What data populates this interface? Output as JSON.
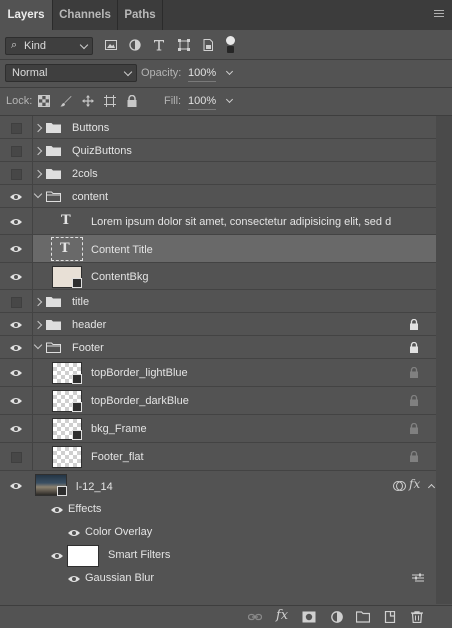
{
  "tabs": [
    {
      "label": "Layers",
      "active": true
    },
    {
      "label": "Channels",
      "active": false
    },
    {
      "label": "Paths",
      "active": false
    }
  ],
  "filter": {
    "kind_label": "Kind"
  },
  "blend": {
    "mode": "Normal",
    "opacity_label": "Opacity:",
    "opacity_value": "100%",
    "lock_label": "Lock:",
    "fill_label": "Fill:",
    "fill_value": "100%"
  },
  "layers": [
    {
      "name": "Buttons",
      "type": "group",
      "visible": false,
      "expanded": false,
      "indent": 0
    },
    {
      "name": "QuizButtons",
      "type": "group",
      "visible": false,
      "expanded": false,
      "indent": 0
    },
    {
      "name": "2cols",
      "type": "group",
      "visible": false,
      "expanded": false,
      "indent": 0
    },
    {
      "name": "content",
      "type": "group",
      "visible": true,
      "expanded": true,
      "indent": 0
    },
    {
      "name": "Lorem ipsum dolor sit amet, consectetur adipisicing elit, sed d",
      "type": "text",
      "visible": true,
      "indent": 1
    },
    {
      "name": "Content Title",
      "type": "text",
      "visible": true,
      "indent": 1,
      "selected": true
    },
    {
      "name": "ContentBkg",
      "type": "smart-object",
      "visible": true,
      "indent": 1
    },
    {
      "name": "title",
      "type": "group",
      "visible": false,
      "expanded": false,
      "indent": 0
    },
    {
      "name": "header",
      "type": "group",
      "visible": true,
      "expanded": false,
      "indent": 0,
      "locked": true
    },
    {
      "name": "Footer",
      "type": "group",
      "visible": true,
      "expanded": true,
      "indent": 0,
      "locked": true
    },
    {
      "name": "topBorder_lightBlue",
      "type": "smart-object",
      "visible": true,
      "indent": 1,
      "locked": true
    },
    {
      "name": "topBorder_darkBlue",
      "type": "smart-object",
      "visible": true,
      "indent": 1,
      "locked": true
    },
    {
      "name": "bkg_Frame",
      "type": "smart-object",
      "visible": true,
      "indent": 1,
      "locked": true
    },
    {
      "name": "Footer_flat",
      "type": "pixel",
      "visible": false,
      "indent": 1,
      "locked": true
    },
    {
      "name": "l-12_14",
      "type": "image",
      "visible": true,
      "indent": 0
    }
  ],
  "effects": {
    "label": "Effects",
    "items": [
      "Color Overlay"
    ],
    "smart_filters_label": "Smart Filters",
    "filters": [
      "Gaussian Blur"
    ]
  },
  "fx_badge": "fx",
  "bottom_fx": "fx"
}
